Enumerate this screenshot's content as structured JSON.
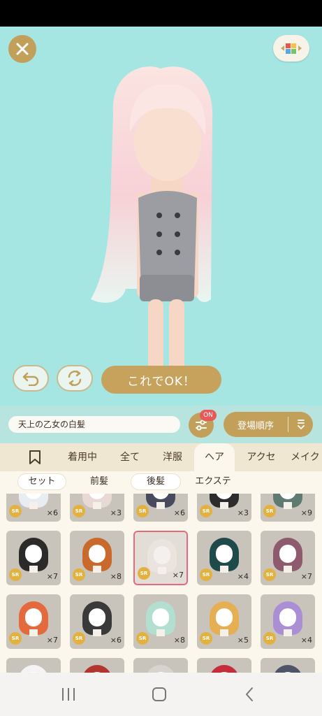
{
  "ok_button": "これでOK！",
  "item_name": "天上の乙女の白髪",
  "filter_badge": "ON",
  "sort_label": "登場順序",
  "tabs": [
    {
      "label": "着用中"
    },
    {
      "label": "全て"
    },
    {
      "label": "洋服"
    },
    {
      "label": "ヘア"
    },
    {
      "label": "アクセ"
    },
    {
      "label": "メイク"
    }
  ],
  "subtabs": [
    "セット",
    "前髪",
    "後髪",
    "エクステ"
  ],
  "rarity": "SR",
  "grid": [
    {
      "count": "×6",
      "hair": "#e8edf2"
    },
    {
      "count": "×3",
      "hair": "#e8d8d6"
    },
    {
      "count": "×6",
      "hair": "#4a4a5e"
    },
    {
      "count": "×3",
      "hair": "#2c2c2c"
    },
    {
      "count": "×9",
      "hair": "#5f7a70"
    },
    {
      "count": "×7",
      "hair": "#2d2a2a"
    },
    {
      "count": "×8",
      "hair": "#c9692b"
    },
    {
      "count": "×7",
      "hair": "#f3ece8"
    },
    {
      "count": "×4",
      "hair": "#1f4a4a"
    },
    {
      "count": "×7",
      "hair": "#8e5a6e"
    },
    {
      "count": "×7",
      "hair": "#e46a3e"
    },
    {
      "count": "×6",
      "hair": "#3a3a3a"
    },
    {
      "count": "×8",
      "hair": "#b3dfd0"
    },
    {
      "count": "×5",
      "hair": "#e5b053"
    },
    {
      "count": "×4",
      "hair": "#ab8fd4"
    },
    {
      "count": "",
      "hair": "#f4f4f4"
    },
    {
      "count": "",
      "hair": "#b3362e"
    },
    {
      "count": "",
      "hair": "#d9d3ce"
    },
    {
      "count": "",
      "hair": "#c72c3a"
    },
    {
      "count": "",
      "hair": "#4e5568"
    }
  ],
  "colors": {
    "accent": "#c2a05a",
    "background": "#a5e5e2",
    "selected_border": "#e36b7c",
    "badge": "#e85a5a"
  },
  "icons": [
    "close-icon",
    "palette-menu-icon",
    "undo-icon",
    "rotate-icon",
    "filter-sliders-icon",
    "sort-icon",
    "bookmark-icon",
    "recents-icon",
    "home-icon",
    "back-icon"
  ]
}
